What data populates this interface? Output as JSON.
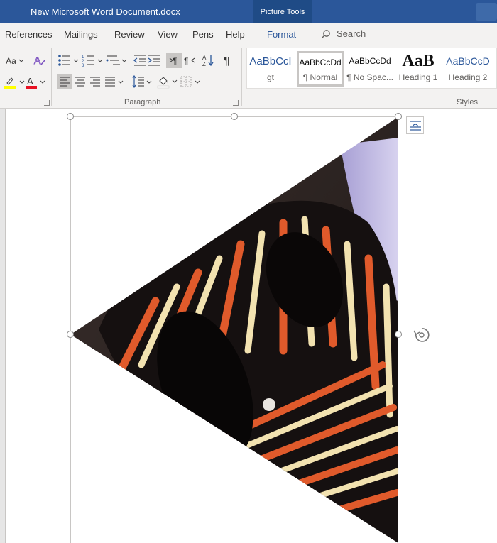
{
  "titlebar": {
    "doc_title": "New Microsoft Word Document.docx",
    "context_tab": "Picture Tools"
  },
  "tabs": [
    "References",
    "Mailings",
    "Review",
    "View",
    "Pens",
    "Help",
    "Format"
  ],
  "active_tab": "Format",
  "search": {
    "label": "Search"
  },
  "font_group": {
    "case_label": "Aa"
  },
  "groups": {
    "paragraph": "Paragraph",
    "styles": "Styles"
  },
  "styles": [
    {
      "sample": "AaBbCcI",
      "label": "gt"
    },
    {
      "sample": "AaBbCcDd",
      "label": "¶ Normal"
    },
    {
      "sample": "AaBbCcDd",
      "label": "¶ No Spac..."
    },
    {
      "sample": "AaB",
      "label": "Heading 1"
    },
    {
      "sample": "AaBbCcD",
      "label": "Heading 2"
    }
  ],
  "colors": {
    "title_bar": "#2b579a",
    "ribbon": "#f3f2f1",
    "highlight": "#ffff00",
    "font_color": "#e81123",
    "accent": "#2b579a"
  },
  "icons": [
    "search-icon",
    "text-effects-icon",
    "highlight-icon",
    "font-color-icon",
    "bullets-icon",
    "numbering-icon",
    "multilevel-list-icon",
    "decrease-indent-icon",
    "increase-indent-icon",
    "ltr-icon",
    "rtl-icon",
    "sort-icon",
    "pilcrow-icon",
    "align-left-icon",
    "align-center-icon",
    "align-right-icon",
    "justify-icon",
    "line-spacing-icon",
    "shading-icon",
    "borders-icon",
    "layout-options-icon",
    "rotate-handle-icon"
  ]
}
